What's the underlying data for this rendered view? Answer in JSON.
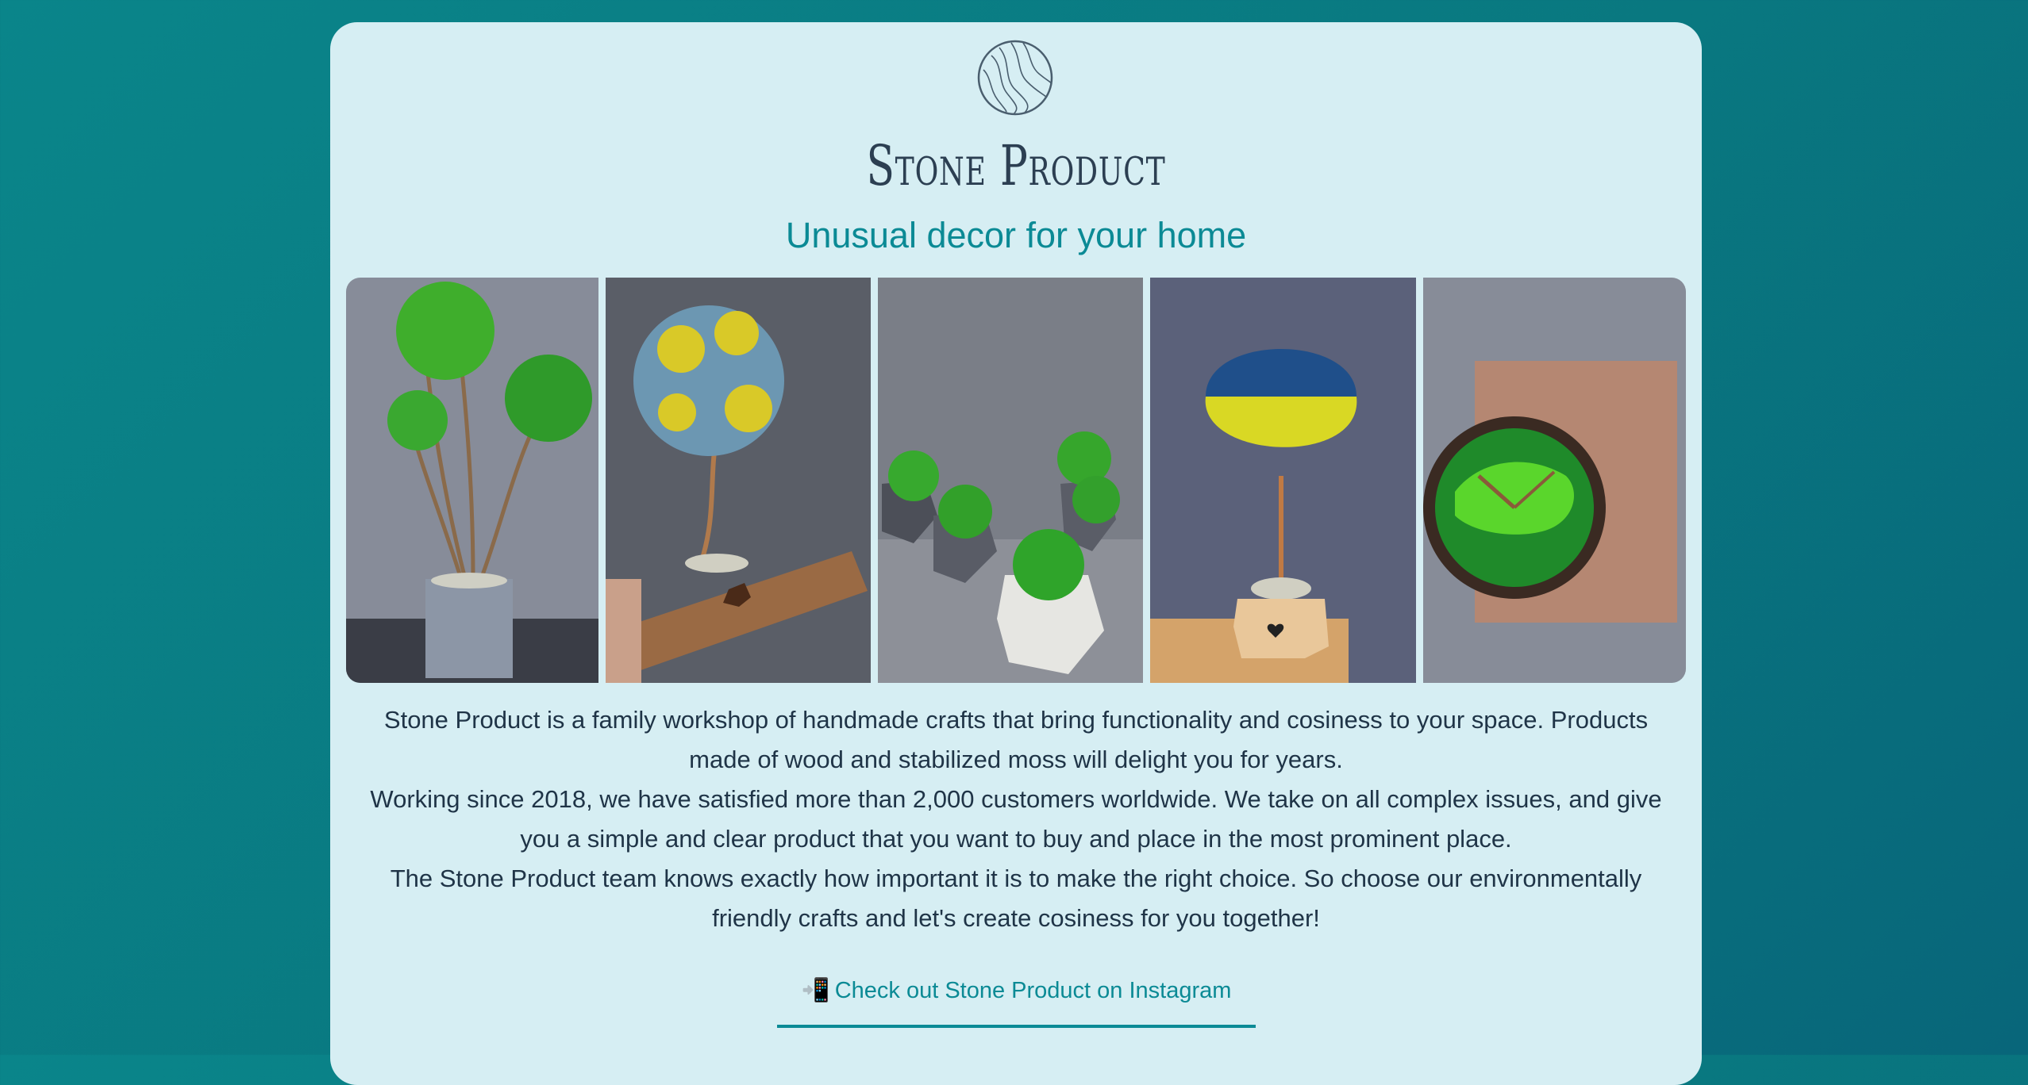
{
  "header": {
    "logo_icon": "stone-slice-logo",
    "brand": "Stone Product",
    "tagline": "Unusual decor for your home"
  },
  "gallery": {
    "images": [
      {
        "name": "moss-topiary-three-balls",
        "icon": "product-photo"
      },
      {
        "name": "moss-tree-blue-yellow-wood-base",
        "icon": "product-photo"
      },
      {
        "name": "moss-pots-geometric",
        "icon": "product-photo"
      },
      {
        "name": "moss-tree-ukraine-colors",
        "icon": "product-photo"
      },
      {
        "name": "moss-wall-clock",
        "icon": "product-photo"
      }
    ]
  },
  "description": {
    "p1": "Stone Product is a family workshop of handmade crafts that bring functionality and cosiness to your space. Products made of wood and stabilized moss will delight you for years.",
    "p2": "Working since 2018, we have satisfied more than 2,000 customers worldwide. We take on all complex issues, and give you a simple and clear product that you want to buy and place in the most prominent place.",
    "p3": "The Stone Product team knows exactly how important it is to make the right choice. So choose our environmentally friendly crafts and let's create cosiness for you together!"
  },
  "cta": {
    "icon": "mobile-phone-arrow-icon",
    "emoji": "📲",
    "label": "Check out Stone Product on Instagram"
  },
  "colors": {
    "background": "#0a858a",
    "card": "#d6eef3",
    "accent": "#0b8a95",
    "text": "#1f3447",
    "brand": "#2c3f52"
  }
}
